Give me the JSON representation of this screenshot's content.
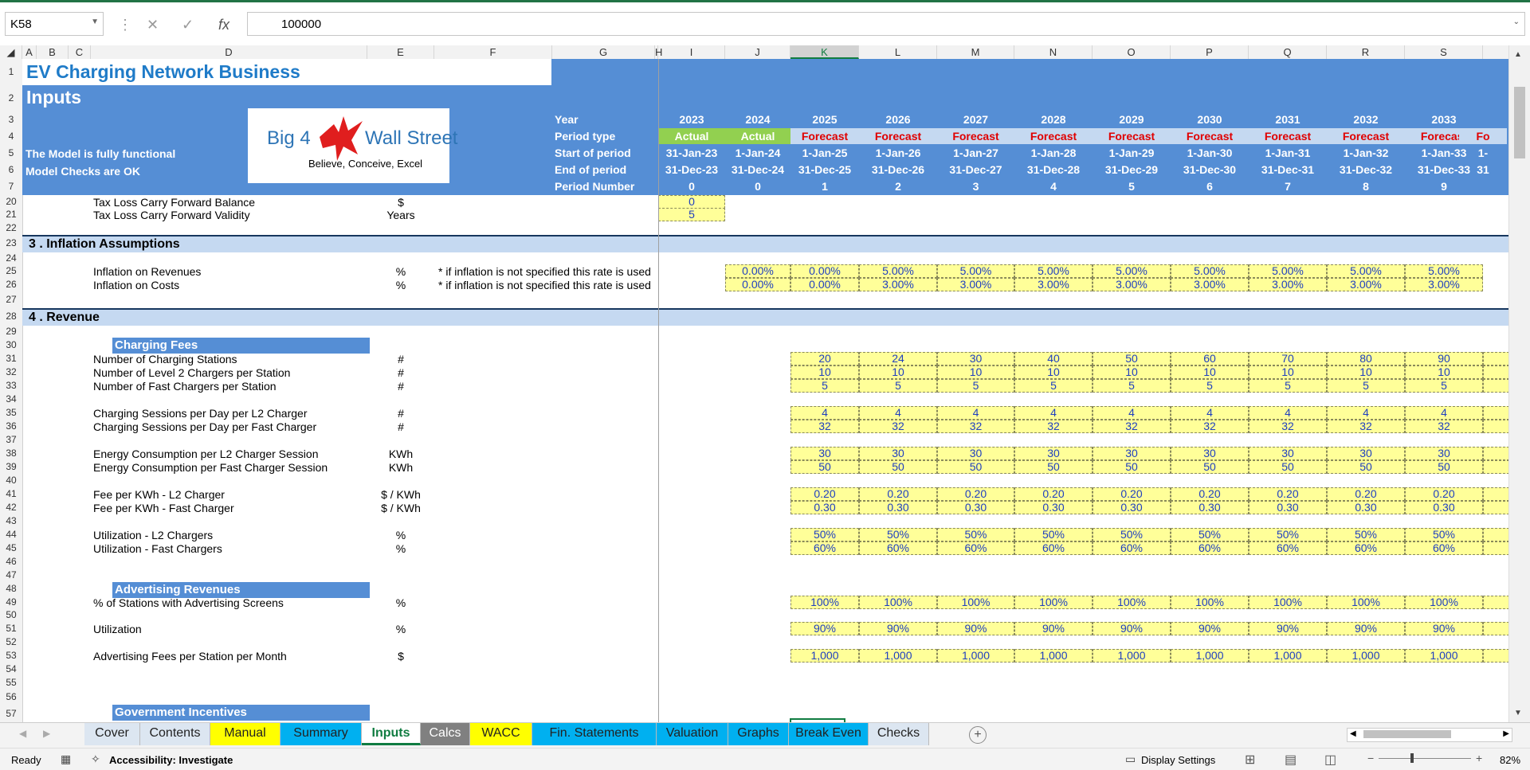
{
  "formula_bar": {
    "name_box": "K58",
    "cancel_icon": "✕",
    "enter_icon": "✓",
    "fx_label": "fx",
    "formula": "100000"
  },
  "columns": [
    "A",
    "B",
    "C",
    "D",
    "E",
    "F",
    "G",
    "H",
    "I",
    "J",
    "K",
    "L",
    "M",
    "N",
    "O",
    "P",
    "Q",
    "R",
    "S"
  ],
  "rows": [
    "1",
    "2",
    "3",
    "4",
    "5",
    "6",
    "7",
    "20",
    "21",
    "22",
    "23",
    "24",
    "25",
    "26",
    "27",
    "28",
    "29",
    "30",
    "31",
    "32",
    "33",
    "34",
    "35",
    "36",
    "37",
    "38",
    "39",
    "40",
    "41",
    "42",
    "43",
    "44",
    "45",
    "46",
    "47",
    "48",
    "49",
    "50",
    "51",
    "52",
    "53",
    "54",
    "55",
    "56",
    "57"
  ],
  "header": {
    "title": "EV Charging Network Business",
    "subtitle": "Inputs",
    "status1": "The Model is fully functional",
    "status2": "Model Checks are OK",
    "logo_left": "Big 4",
    "logo_right": "Wall Street",
    "logo_tagline": "Believe, Conceive, Excel",
    "row_labels": [
      "Year",
      "Period type",
      "Start of period",
      "End of period",
      "Period Number"
    ],
    "years": [
      "2023",
      "2024",
      "2025",
      "2026",
      "2027",
      "2028",
      "2029",
      "2030",
      "2031",
      "2032",
      "2033"
    ],
    "period_types": [
      "Actual",
      "Actual",
      "Forecast",
      "Forecast",
      "Forecast",
      "Forecast",
      "Forecast",
      "Forecast",
      "Forecast",
      "Forecast",
      "Forecast",
      "Fo"
    ],
    "start": [
      "31-Jan-23",
      "1-Jan-24",
      "1-Jan-25",
      "1-Jan-26",
      "1-Jan-27",
      "1-Jan-28",
      "1-Jan-29",
      "1-Jan-30",
      "1-Jan-31",
      "1-Jan-32",
      "1-Jan-33",
      "1-"
    ],
    "end": [
      "31-Dec-23",
      "31-Dec-24",
      "31-Dec-25",
      "31-Dec-26",
      "31-Dec-27",
      "31-Dec-28",
      "31-Dec-29",
      "31-Dec-30",
      "31-Dec-31",
      "31-Dec-32",
      "31-Dec-33",
      "31"
    ],
    "period_numbers": [
      "0",
      "0",
      "1",
      "2",
      "3",
      "4",
      "5",
      "6",
      "7",
      "8",
      "9"
    ]
  },
  "tax": {
    "rows": [
      {
        "label": "Tax Loss Carry Forward Balance",
        "unit": "$",
        "value": "0"
      },
      {
        "label": "Tax Loss Carry Forward Validity",
        "unit": "Years",
        "value": "5"
      }
    ]
  },
  "inflation": {
    "title": "3 . Inflation Assumptions",
    "rows": [
      {
        "label": "Inflation on Revenues",
        "unit": "%",
        "note": "* if inflation is not specified this rate is used",
        "values": [
          "0.00%",
          "0.00%",
          "5.00%",
          "5.00%",
          "5.00%",
          "5.00%",
          "5.00%",
          "5.00%",
          "5.00%",
          "5.00%"
        ]
      },
      {
        "label": "Inflation on Costs",
        "unit": "%",
        "note": "* if inflation is not specified this rate is used",
        "values": [
          "0.00%",
          "0.00%",
          "3.00%",
          "3.00%",
          "3.00%",
          "3.00%",
          "3.00%",
          "3.00%",
          "3.00%",
          "3.00%"
        ]
      }
    ]
  },
  "revenue": {
    "title": "4 . Revenue",
    "charging_header": "Charging Fees",
    "advertising_header": "Advertising Revenues",
    "gov_header": "Government Incentives",
    "rows": [
      {
        "label": "Number of Charging Stations",
        "unit": "#",
        "values": [
          "20",
          "24",
          "30",
          "40",
          "50",
          "60",
          "70",
          "80",
          "90"
        ]
      },
      {
        "label": "Number of Level 2 Chargers per Station",
        "unit": "#",
        "values": [
          "10",
          "10",
          "10",
          "10",
          "10",
          "10",
          "10",
          "10",
          "10"
        ]
      },
      {
        "label": "Number of Fast Chargers per Station",
        "unit": "#",
        "values": [
          "5",
          "5",
          "5",
          "5",
          "5",
          "5",
          "5",
          "5",
          "5"
        ]
      },
      {
        "label": "Charging Sessions per Day per L2 Charger",
        "unit": "#",
        "values": [
          "4",
          "4",
          "4",
          "4",
          "4",
          "4",
          "4",
          "4",
          "4"
        ]
      },
      {
        "label": "Charging Sessions per Day per Fast Charger",
        "unit": "#",
        "values": [
          "32",
          "32",
          "32",
          "32",
          "32",
          "32",
          "32",
          "32",
          "32"
        ]
      },
      {
        "label": "Energy Consumption per L2 Charger Session",
        "unit": "KWh",
        "values": [
          "30",
          "30",
          "30",
          "30",
          "30",
          "30",
          "30",
          "30",
          "30"
        ]
      },
      {
        "label": "Energy Consumption per Fast Charger Session",
        "unit": "KWh",
        "values": [
          "50",
          "50",
          "50",
          "50",
          "50",
          "50",
          "50",
          "50",
          "50"
        ]
      },
      {
        "label": "Fee per KWh - L2 Charger",
        "unit": "$ / KWh",
        "values": [
          "0.20",
          "0.20",
          "0.20",
          "0.20",
          "0.20",
          "0.20",
          "0.20",
          "0.20",
          "0.20"
        ]
      },
      {
        "label": "Fee per KWh - Fast Charger",
        "unit": "$ / KWh",
        "values": [
          "0.30",
          "0.30",
          "0.30",
          "0.30",
          "0.30",
          "0.30",
          "0.30",
          "0.30",
          "0.30"
        ]
      },
      {
        "label": "Utilization - L2 Chargers",
        "unit": "%",
        "values": [
          "50%",
          "50%",
          "50%",
          "50%",
          "50%",
          "50%",
          "50%",
          "50%",
          "50%"
        ]
      },
      {
        "label": "Utilization - Fast Chargers",
        "unit": "%",
        "values": [
          "60%",
          "60%",
          "60%",
          "60%",
          "60%",
          "60%",
          "60%",
          "60%",
          "60%"
        ]
      },
      {
        "label": "% of Stations with Advertising Screens",
        "unit": "%",
        "values": [
          "100%",
          "100%",
          "100%",
          "100%",
          "100%",
          "100%",
          "100%",
          "100%",
          "100%"
        ]
      },
      {
        "label": "Utilization",
        "unit": "%",
        "values": [
          "90%",
          "90%",
          "90%",
          "90%",
          "90%",
          "90%",
          "90%",
          "90%",
          "90%"
        ]
      },
      {
        "label": "Advertising Fees per Station per Month",
        "unit": "$",
        "values": [
          "1,000",
          "1,000",
          "1,000",
          "1,000",
          "1,000",
          "1,000",
          "1,000",
          "1,000",
          "1,000"
        ]
      }
    ]
  },
  "sheet_tabs": [
    {
      "label": "Cover",
      "color": "#dce6f1"
    },
    {
      "label": "Contents",
      "color": "#dce6f1"
    },
    {
      "label": "Manual",
      "color": "#ffff00"
    },
    {
      "label": "Summary",
      "color": "#00b0f0"
    },
    {
      "label": "Inputs",
      "color": "#ffffff"
    },
    {
      "label": "Calcs",
      "color": "#808080"
    },
    {
      "label": "WACC",
      "color": "#ffff00"
    },
    {
      "label": "Fin. Statements",
      "color": "#00b0f0"
    },
    {
      "label": "Valuation",
      "color": "#00b0f0"
    },
    {
      "label": "Graphs",
      "color": "#00b0f0"
    },
    {
      "label": "Break Even",
      "color": "#00b0f0"
    },
    {
      "label": "Checks",
      "color": "#dce6f1"
    }
  ],
  "status_bar": {
    "ready": "Ready",
    "accessibility": "Accessibility: Investigate",
    "display_settings": "Display Settings",
    "zoom": "82%"
  }
}
